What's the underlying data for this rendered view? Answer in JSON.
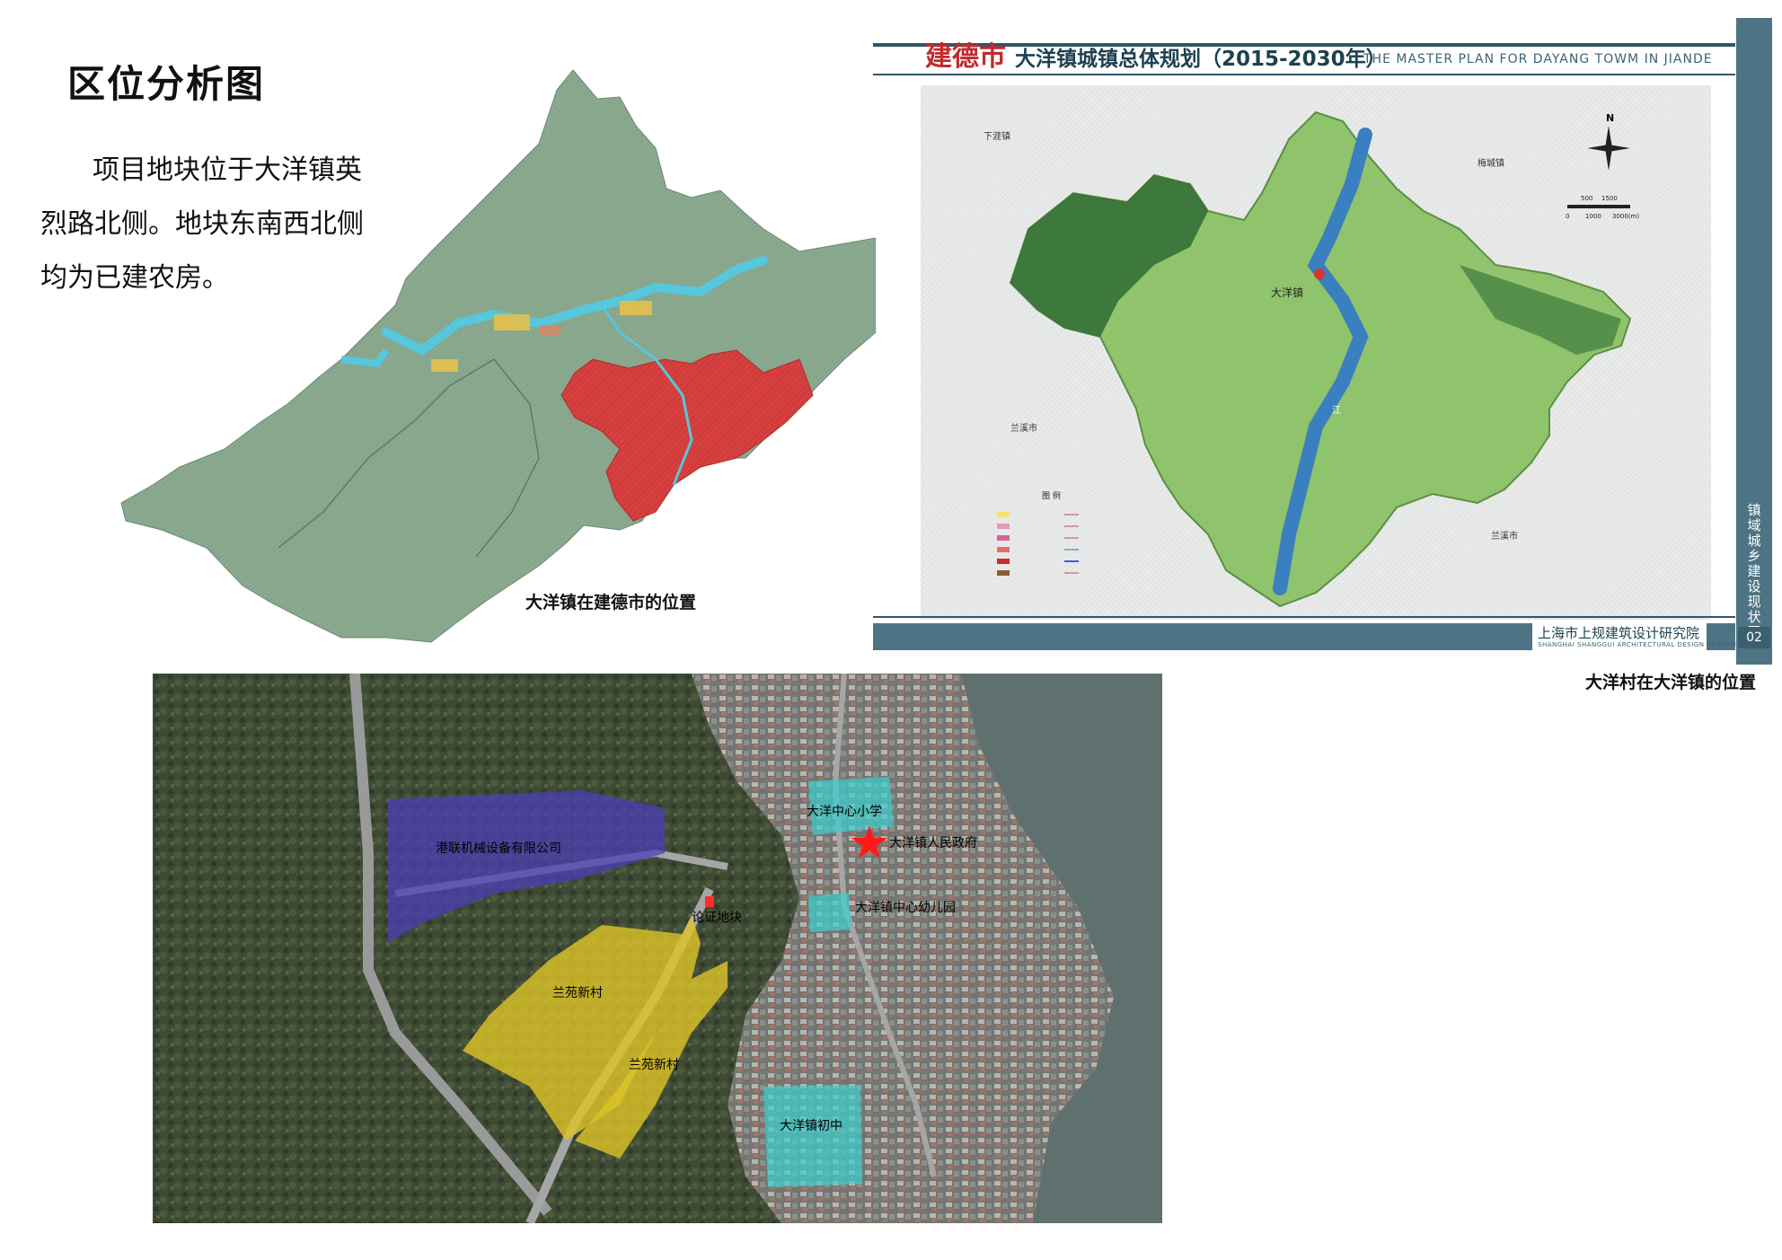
{
  "page": {
    "title": "区位分析图",
    "description_lines": [
      "项目地块位于大洋镇英",
      "烈路北侧。地块东南西北侧",
      "均为已建农房。"
    ]
  },
  "map1": {
    "caption": "大洋镇在建德市的位置",
    "colors": {
      "terrain": "#8aa98f",
      "highlight": "#d7403f",
      "water": "#56c7dc",
      "urban": "#e4c04a"
    }
  },
  "map2": {
    "title_brand": "建德市",
    "title_main": "大洋镇城镇总体规划（2015-2030年）",
    "title_en": "THE MASTER PLAN FOR DAYANG TOWM IN JIANDE",
    "side_label": "镇域城乡建设现状图",
    "page_no": "02",
    "org_cn": "上海市上规建筑设计研究院",
    "org_en": "SHANGHAI SHANGGUI ARCHITECTURAL DESIGN ACADEMY",
    "caption": "大洋村在大洋镇的位置",
    "center_label": "大洋镇",
    "place_labels": {
      "north_west": "下涯镇",
      "north_east": "梅城镇",
      "west": "兰溪市",
      "south_east": "兰溪市",
      "river": "江"
    },
    "compass": "N",
    "scale_labels": [
      "0",
      "500",
      "1000",
      "1500",
      "3000(m)"
    ],
    "legend_title": "图 例",
    "colors": {
      "terrain_dark": "#2f6b34",
      "terrain_light": "#9ccc7a",
      "river": "#3a7fc0",
      "frame": "#4d7484"
    }
  },
  "map3": {
    "labels": {
      "company": "港联机械设备有限公司",
      "school": "大洋中心小学",
      "government": "大洋镇人民政府",
      "site": "论证地块",
      "kindergarten": "大洋镇中心幼儿园",
      "village_a": "兰苑新村",
      "village_b": "兰苑新村",
      "middle_school": "大洋镇初中"
    },
    "colors": {
      "company": "#4b3db5",
      "school": "#3ad0d0",
      "village": "#e0c427",
      "site": "#ff2d2d",
      "star": "#ff1a1a"
    }
  }
}
